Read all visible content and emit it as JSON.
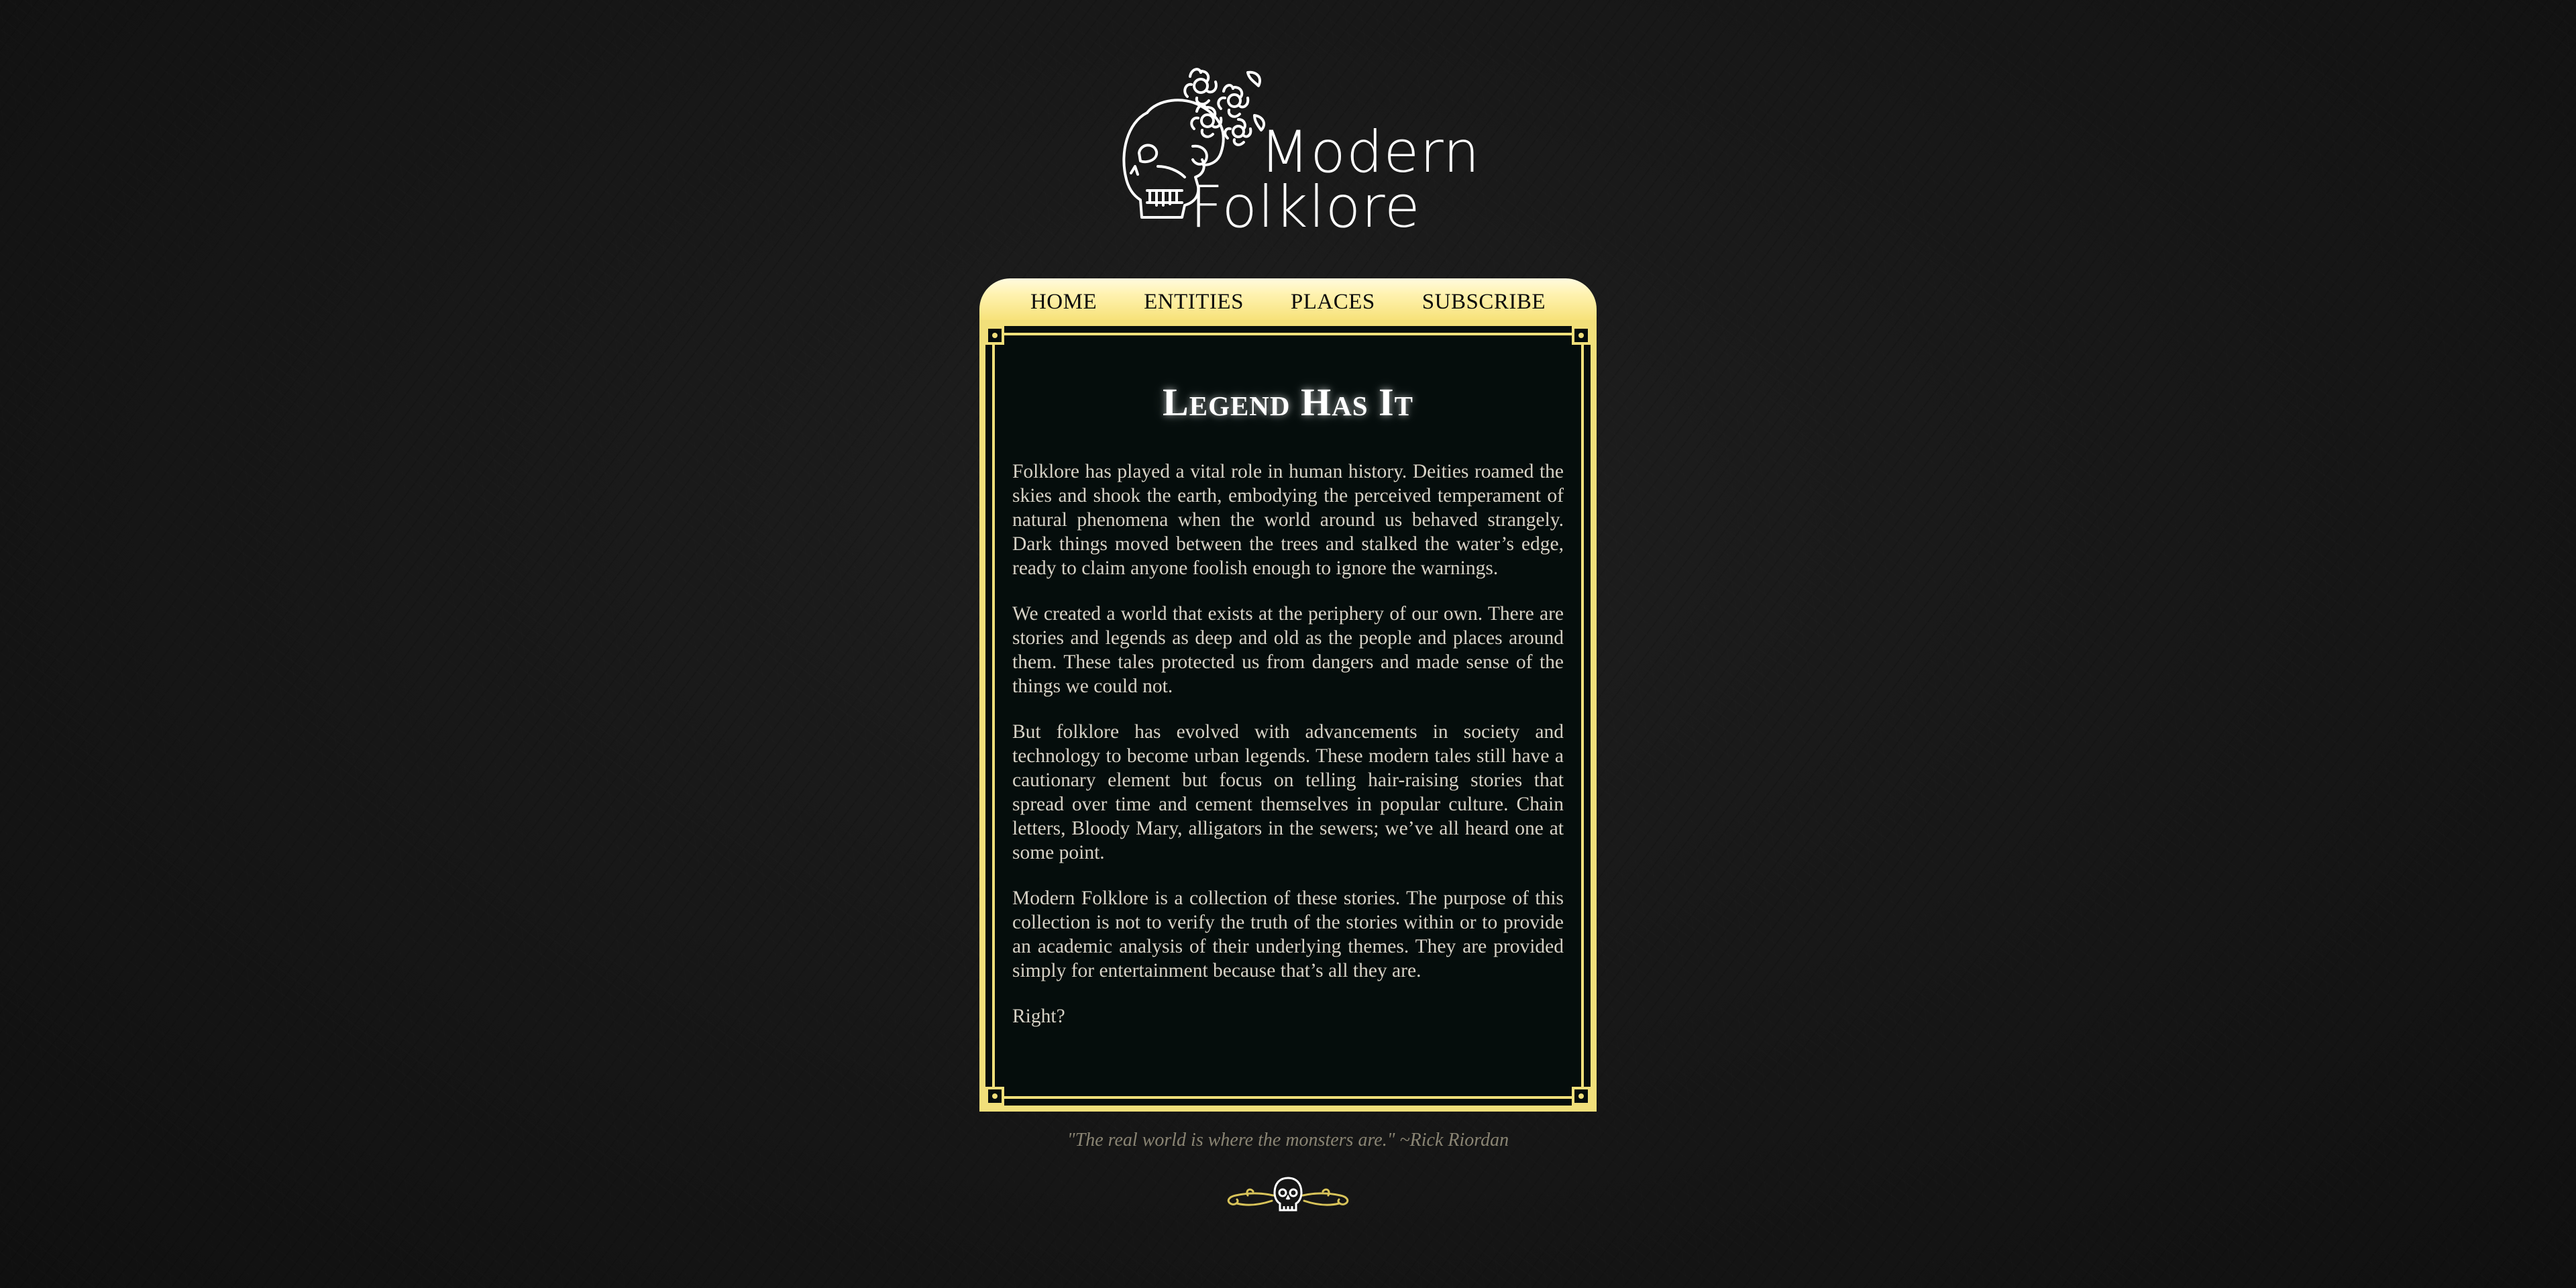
{
  "logo": {
    "line1": "Modern",
    "line2": "Folklore",
    "icon": "skull-with-flowers-icon"
  },
  "nav": {
    "items": [
      {
        "label": "HOME"
      },
      {
        "label": "ENTITIES"
      },
      {
        "label": "PLACES"
      },
      {
        "label": "SUBSCRIBE"
      }
    ]
  },
  "article": {
    "title": "Legend Has It",
    "paragraphs": [
      "Folklore has played a vital role in human history. Deities roamed the skies and shook the earth, embodying the perceived temperament of natural phenomena when the world around us behaved strangely. Dark things moved between the trees and stalked the water’s edge, ready to claim anyone foolish enough to ignore the warnings.",
      "We created a world that exists at the periphery of our own. There are stories and legends as deep and old as the people and places around them. These tales protected us from dangers and made sense of the things we could not.",
      "But folklore has evolved with advancements in society and technology to become urban legends. These modern tales still have a cautionary element but focus on telling hair-raising stories that spread over time and cement themselves in popular culture. Chain letters, Bloody Mary, alligators in the sewers; we’ve all heard one at some point.",
      "Modern Folklore is a collection of these stories. The purpose of this collection is not to verify the truth of the stories within or to provide an academic analysis of their underlying themes. They are provided simply for entertainment because that’s all they are.",
      "Right?"
    ]
  },
  "footer": {
    "quote": "\"The real world is where the monsters are.\" ~Rick Riordan",
    "ornament": "skull-flourish-icon"
  },
  "colors": {
    "gold": "#f1df7a",
    "card_bg": "#050d0c",
    "page_bg": "#1b1b1b"
  }
}
